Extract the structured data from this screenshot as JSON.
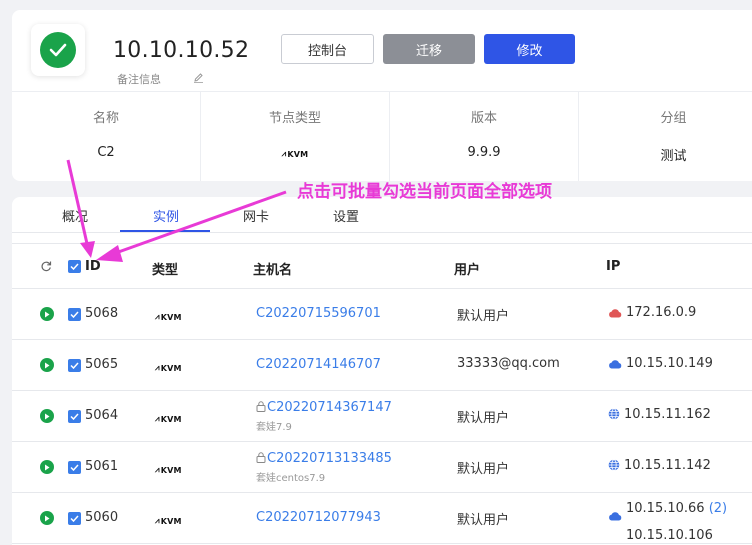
{
  "host": {
    "ip": "10.10.10.52",
    "remark_label": "备注信息",
    "status_icon": "check-circle-icon",
    "status_color": "#1aa34a"
  },
  "actions": {
    "console": "控制台",
    "migrate": "迁移",
    "edit": "修改"
  },
  "info": [
    {
      "label": "名称",
      "value": "C2"
    },
    {
      "label": "节点类型",
      "value": "KVM"
    },
    {
      "label": "版本",
      "value": "9.9.9"
    },
    {
      "label": "分组",
      "value": "测试"
    }
  ],
  "tabs": [
    {
      "label": "概况",
      "active": false
    },
    {
      "label": "实例",
      "active": true
    },
    {
      "label": "网卡",
      "active": false
    },
    {
      "label": "设置",
      "active": false
    }
  ],
  "table": {
    "headers": {
      "id": "ID",
      "type": "类型",
      "hostname": "主机名",
      "user": "用户",
      "ip": "IP"
    },
    "rows": [
      {
        "id": "5068",
        "type": "KVM",
        "hostname": "C20220715596701",
        "locked": false,
        "sub": "",
        "user": "默认用户",
        "ip_icon": "cloud-icon",
        "ip_icon_color": "#e05656",
        "ip": "172.16.0.9",
        "ip2": "",
        "ip_count": ""
      },
      {
        "id": "5065",
        "type": "KVM",
        "hostname": "C20220714146707",
        "locked": false,
        "sub": "",
        "user": "33333@qq.com",
        "ip_icon": "cloud-icon",
        "ip_icon_color": "#3a6fe0",
        "ip": "10.15.10.149",
        "ip2": "",
        "ip_count": ""
      },
      {
        "id": "5064",
        "type": "KVM",
        "hostname": "C20220714367147",
        "locked": true,
        "sub": "套娃7.9",
        "user": "默认用户",
        "ip_icon": "globe-icon",
        "ip_icon_color": "#3a6fe0",
        "ip": "10.15.11.162",
        "ip2": "",
        "ip_count": ""
      },
      {
        "id": "5061",
        "type": "KVM",
        "hostname": "C20220713133485",
        "locked": true,
        "sub": "套娃centos7.9",
        "user": "默认用户",
        "ip_icon": "globe-icon",
        "ip_icon_color": "#3a6fe0",
        "ip": "10.15.11.142",
        "ip2": "",
        "ip_count": ""
      },
      {
        "id": "5060",
        "type": "KVM",
        "hostname": "C20220712077943",
        "locked": false,
        "sub": "",
        "user": "默认用户",
        "ip_icon": "cloud-icon",
        "ip_icon_color": "#3a6fe0",
        "ip": "10.15.10.66",
        "ip2": "10.15.10.106",
        "ip_count": "(2)"
      }
    ]
  },
  "annotation": {
    "text": "点击可批量勾选当前页面全部选项",
    "color": "#e83ad6"
  }
}
